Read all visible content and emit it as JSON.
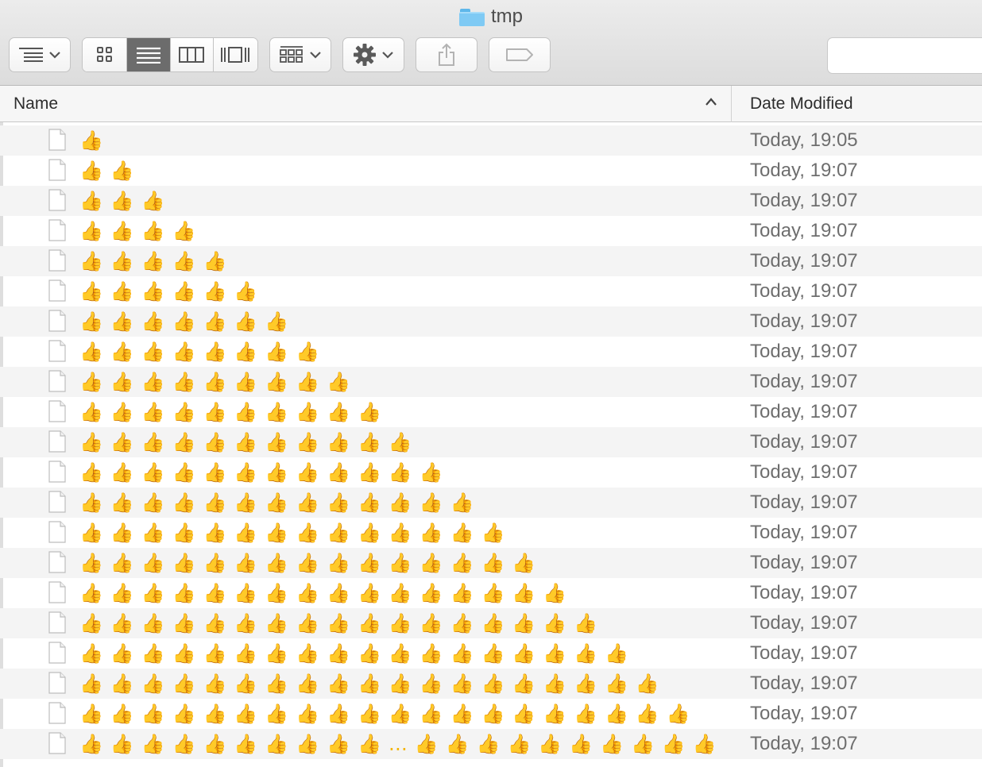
{
  "window": {
    "title": "tmp",
    "folder_icon": "folder-icon"
  },
  "toolbar": {
    "buttons": [
      {
        "name": "view-options-menu",
        "icon": "list-lines-icon"
      },
      {
        "name": "view-mode-icons",
        "icon": "grid-icon"
      },
      {
        "name": "view-mode-list",
        "icon": "list-icon",
        "active": true
      },
      {
        "name": "view-mode-columns",
        "icon": "columns-icon"
      },
      {
        "name": "view-mode-coverflow",
        "icon": "coverflow-icon"
      },
      {
        "name": "arrange-menu",
        "icon": "arrange-icon"
      },
      {
        "name": "action-menu",
        "icon": "gear-icon"
      },
      {
        "name": "share-button",
        "icon": "share-icon"
      },
      {
        "name": "tags-button",
        "icon": "tag-icon"
      }
    ],
    "search_placeholder": ""
  },
  "columns": {
    "name": "Name",
    "date_modified": "Date Modified",
    "sort_direction": "ascending"
  },
  "files": [
    {
      "name": "👍",
      "date": "Today, 19:05"
    },
    {
      "name": "👍👍",
      "date": "Today, 19:07"
    },
    {
      "name": "👍👍👍",
      "date": "Today, 19:07"
    },
    {
      "name": "👍👍👍👍",
      "date": "Today, 19:07"
    },
    {
      "name": "👍👍👍👍👍",
      "date": "Today, 19:07"
    },
    {
      "name": "👍👍👍👍👍👍",
      "date": "Today, 19:07"
    },
    {
      "name": "👍👍👍👍👍👍👍",
      "date": "Today, 19:07"
    },
    {
      "name": "👍👍👍👍👍👍👍👍",
      "date": "Today, 19:07"
    },
    {
      "name": "👍👍👍👍👍👍👍👍👍",
      "date": "Today, 19:07"
    },
    {
      "name": "👍👍👍👍👍👍👍👍👍👍",
      "date": "Today, 19:07"
    },
    {
      "name": "👍👍👍👍👍👍👍👍👍👍👍",
      "date": "Today, 19:07"
    },
    {
      "name": "👍👍👍👍👍👍👍👍👍👍👍👍",
      "date": "Today, 19:07"
    },
    {
      "name": "👍👍👍👍👍👍👍👍👍👍👍👍👍",
      "date": "Today, 19:07"
    },
    {
      "name": "👍👍👍👍👍👍👍👍👍👍👍👍👍👍",
      "date": "Today, 19:07"
    },
    {
      "name": "👍👍👍👍👍👍👍👍👍👍👍👍👍👍👍",
      "date": "Today, 19:07"
    },
    {
      "name": "👍👍👍👍👍👍👍👍👍👍👍👍👍👍👍👍",
      "date": "Today, 19:07"
    },
    {
      "name": "👍👍👍👍👍👍👍👍👍👍👍👍👍👍👍👍👍",
      "date": "Today, 19:07"
    },
    {
      "name": "👍👍👍👍👍👍👍👍👍👍👍👍👍👍👍👍👍👍",
      "date": "Today, 19:07"
    },
    {
      "name": "👍👍👍👍👍👍👍👍👍👍👍👍👍👍👍👍👍👍👍",
      "date": "Today, 19:07"
    },
    {
      "name": "👍👍👍👍👍👍👍👍👍👍👍👍👍👍👍👍👍👍👍👍",
      "date": "Today, 19:07"
    },
    {
      "name": "👍👍👍👍👍👍👍👍👍👍…👍👍👍👍👍👍👍👍👍👍",
      "date": "Today, 19:07"
    }
  ],
  "colors": {
    "thumb": "#f3b400",
    "folder": "#7fcaf4",
    "row_alt": "#f4f4f4",
    "active_segment": "#6c6c6c"
  }
}
